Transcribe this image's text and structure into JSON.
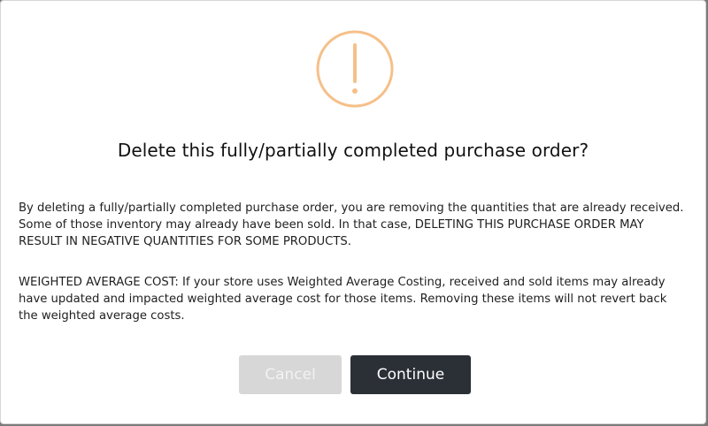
{
  "dialog": {
    "icon": "exclamation-circle-icon",
    "icon_color": "#f5c089",
    "title": "Delete this fully/partially completed purchase order?",
    "paragraph_1": "By deleting a fully/partially completed purchase order, you are removing the quantities that are already received. Some of those inventory may already have been sold. In that case, DELETING THIS PURCHASE ORDER MAY RESULT IN NEGATIVE QUANTITIES FOR SOME PRODUCTS.",
    "paragraph_2": "WEIGHTED AVERAGE COST: If your store uses Weighted Average Costing, received and sold items may already have updated and impacted weighted average cost for those items. Removing these items will not revert back the weighted average costs.",
    "cancel_label": "Cancel",
    "continue_label": "Continue",
    "cancel_color": "#d7d7d7",
    "continue_color": "#2b2f36"
  }
}
